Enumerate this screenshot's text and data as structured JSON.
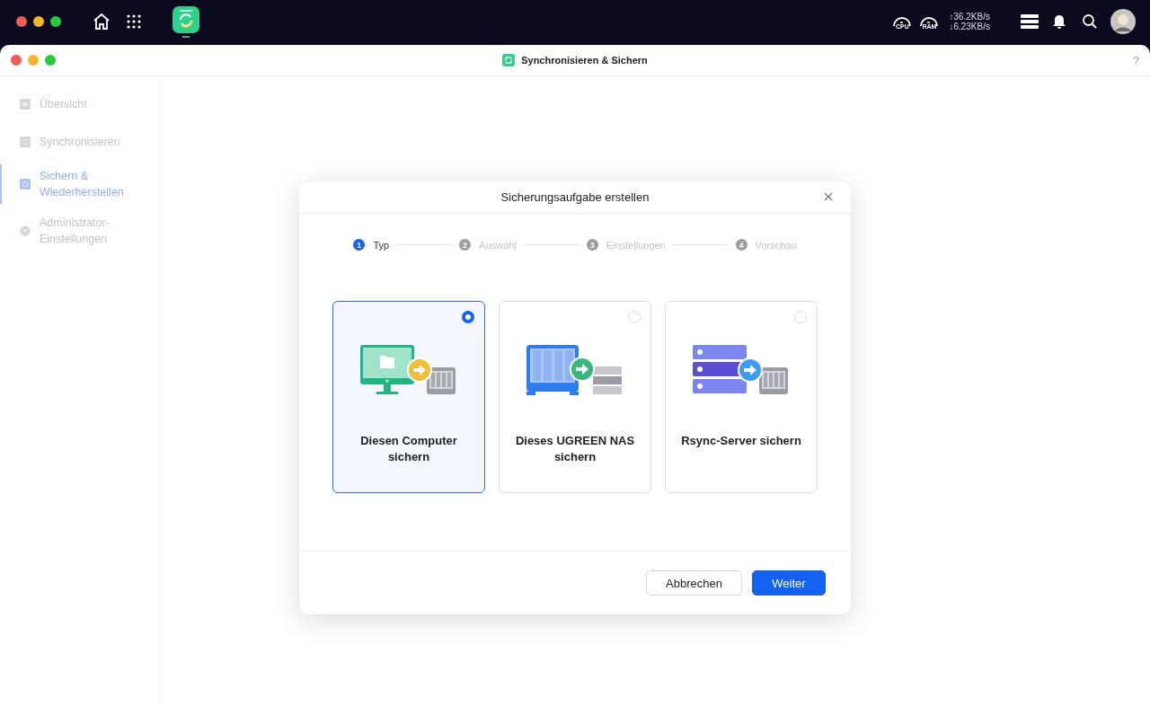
{
  "top_bar": {
    "monitors": [
      {
        "label": "CPU"
      },
      {
        "label": "RAM"
      }
    ],
    "upload": "↑36.2KB/s",
    "download": "↓6.23KB/s"
  },
  "window": {
    "title": "Synchronisieren & Sichern",
    "help": "?"
  },
  "sidebar": {
    "items": [
      {
        "label": "Übersicht",
        "selected": false
      },
      {
        "label": "Synchronisieren",
        "selected": false
      },
      {
        "label": "Sichern & Wiederherstellen",
        "selected": true
      },
      {
        "label": "Administrator-Einstellungen",
        "selected": false
      }
    ]
  },
  "dialog": {
    "title": "Sicherungsaufgabe erstellen",
    "steps": [
      {
        "number": "1",
        "label": "Typ",
        "active": true
      },
      {
        "number": "2",
        "label": "Auswahl",
        "active": false
      },
      {
        "number": "3",
        "label": "Einstellungen",
        "active": false
      },
      {
        "number": "4",
        "label": "Vorschau",
        "active": false
      }
    ],
    "options": [
      {
        "kind": "computer",
        "label": "Diesen Computer sichern",
        "selected": true
      },
      {
        "kind": "nas",
        "label": "Dieses UGREEN NAS sichern",
        "selected": false
      },
      {
        "kind": "rsync",
        "label": "Rsync-Server sichern",
        "selected": false
      }
    ],
    "buttons": [
      {
        "label": "Abbrechen",
        "kind": "secondary"
      },
      {
        "label": "Weiter",
        "kind": "primary"
      }
    ]
  }
}
